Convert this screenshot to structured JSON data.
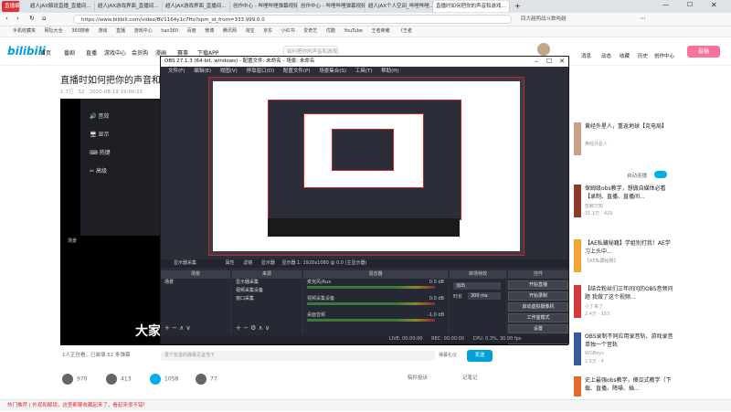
{
  "browser": {
    "badge": "直播编辑",
    "tabs": [
      {
        "label": "超人JAX解说直播_直播间..."
      },
      {
        "label": "超人JAX游戏界面_直播间..."
      },
      {
        "label": "超人JAX游戏界面_直播间..."
      },
      {
        "label": "创作中心 - 哔哩哔哩弹幕视频网"
      },
      {
        "label": "创作中心 - 哔哩哔哩弹幕视频网"
      },
      {
        "label": "超人JAX个人空间_哔哩哔哩..."
      },
      {
        "label": "直播时如何把你的声音和游戏..."
      }
    ],
    "url": "https://www.bilibili.com/video/BV1164y1c7Ho?spm_id_from=333.999.0.0",
    "search_hint": "四大越两战斗数吨越",
    "bookmarks": [
      "手机收藏夹",
      "网址大全",
      "360搜索",
      "游戏",
      "直播",
      "游戏中心",
      "hao360",
      "百度",
      "微博",
      "腾讯网",
      "淘宝",
      "京东",
      "小红书",
      "爱奇艺",
      "优酷",
      "YouTube",
      "王者荣耀",
      "《王者"
    ]
  },
  "bili": {
    "logo": "bilibili",
    "nav": [
      "首页",
      "番剧",
      "直播",
      "游戏中心",
      "会员购",
      "漫画",
      "赛事",
      "下载APP"
    ],
    "search_placeholder": "如何把你的声音和游戏",
    "user_nav": [
      "消息",
      "动态",
      "收藏",
      "历史",
      "创作中心"
    ],
    "upload": "投稿"
  },
  "video": {
    "title": "直播时如何把你的声音和游",
    "views": "1.7万",
    "danmaku_count": "52",
    "date": "2020-08-19 19:00:21"
  },
  "player": {
    "subtitle": "大家",
    "side_labels": [
      "音效",
      "显示",
      "热键",
      "高级"
    ],
    "scene_label": "场景"
  },
  "obs": {
    "title": "OBS 27.1.3 (64-bit, windows) - 配置文件: 未命名 - 场景: 未命名",
    "menu": [
      "文件(F)",
      "编辑(E)",
      "视图(V)",
      "停靠窗口(D)",
      "配置文件(P)",
      "场景集合(S)",
      "工具(T)",
      "帮助(H)"
    ],
    "scene_bar": "显示器采集",
    "scene_bar_buttons": [
      "属性",
      "滤镜",
      "显示器",
      "显示器 1: 1920x1080 @ 0,0 (主显示器)"
    ],
    "dock_headers": [
      "场景",
      "来源",
      "混音器",
      "转场特效",
      "控件"
    ],
    "scenes": [
      "场景"
    ],
    "sources": [
      "显示器采集",
      "视频采集设备",
      "窗口采集"
    ],
    "mixer": [
      {
        "name": "麦克风/Aux",
        "db": "0.0 dB"
      },
      {
        "name": "视频采集设备",
        "db": "0.0 dB"
      },
      {
        "name": "桌面音频",
        "db": "-1.0 dB"
      }
    ],
    "transition": {
      "type": "淡出",
      "duration_label": "时长",
      "duration": "300 ms"
    },
    "controls": [
      "开始直播",
      "开始录制",
      "启动虚拟摄像机",
      "工作室模式",
      "设置",
      "退出"
    ],
    "status": {
      "live": "LIVE: 00:00:00",
      "rec": "REC: 00:00:00",
      "cpu": "CPU: 0.3%, 30.00 fps"
    }
  },
  "danmaku": {
    "online": "1人正在看，已装填 52 条弹幕",
    "placeholder": "发个友善的弹幕见证当下",
    "etiquette": "弹幕礼仪",
    "send": "发送"
  },
  "actions": [
    {
      "label": "970",
      "icon": "like-icon",
      "color": "#61666d"
    },
    {
      "label": "413",
      "icon": "coin-icon",
      "color": "#61666d"
    },
    {
      "label": "1058",
      "icon": "star-icon",
      "color": "#00aeec"
    },
    {
      "label": "77",
      "icon": "share-icon",
      "color": "#61666d"
    }
  ],
  "extra_actions": [
    "稿件投诉",
    "记笔记"
  ],
  "notification": "热门推荐 | 外观和解锁，这里都要收藏起来了，看起来很不错！",
  "sidebar": {
    "auto_play": "自动连播",
    "items": [
      {
        "title": "黄经外星人，重返地球【克电局】",
        "up": "黄经外星人"
      },
      {
        "title": "保姆级obs教学，想做自媒体必看【录制、直播、直播间...",
        "up": "蓝鲸万知",
        "stats": "31.1万 · 429"
      },
      {
        "title": "【AE私藏秘籍】学姐别打我！AE学习上头中...",
        "up": "【AE私藏秘籍】"
      },
      {
        "title": "【结合粉丝们三年间问的OBS音频问题 我做了这个视频...",
        "up": "小丁来了",
        "stats": "2.4万 · 153"
      },
      {
        "title": "OBS录制不同应用录音轨、游戏录音单独一个音轨",
        "up": "WGBoys",
        "stats": "1.5万 · 4"
      },
      {
        "title": "史上最强obs教学，傻瓜式教学（下载、直播、降噪、插...",
        "up": ""
      }
    ]
  }
}
